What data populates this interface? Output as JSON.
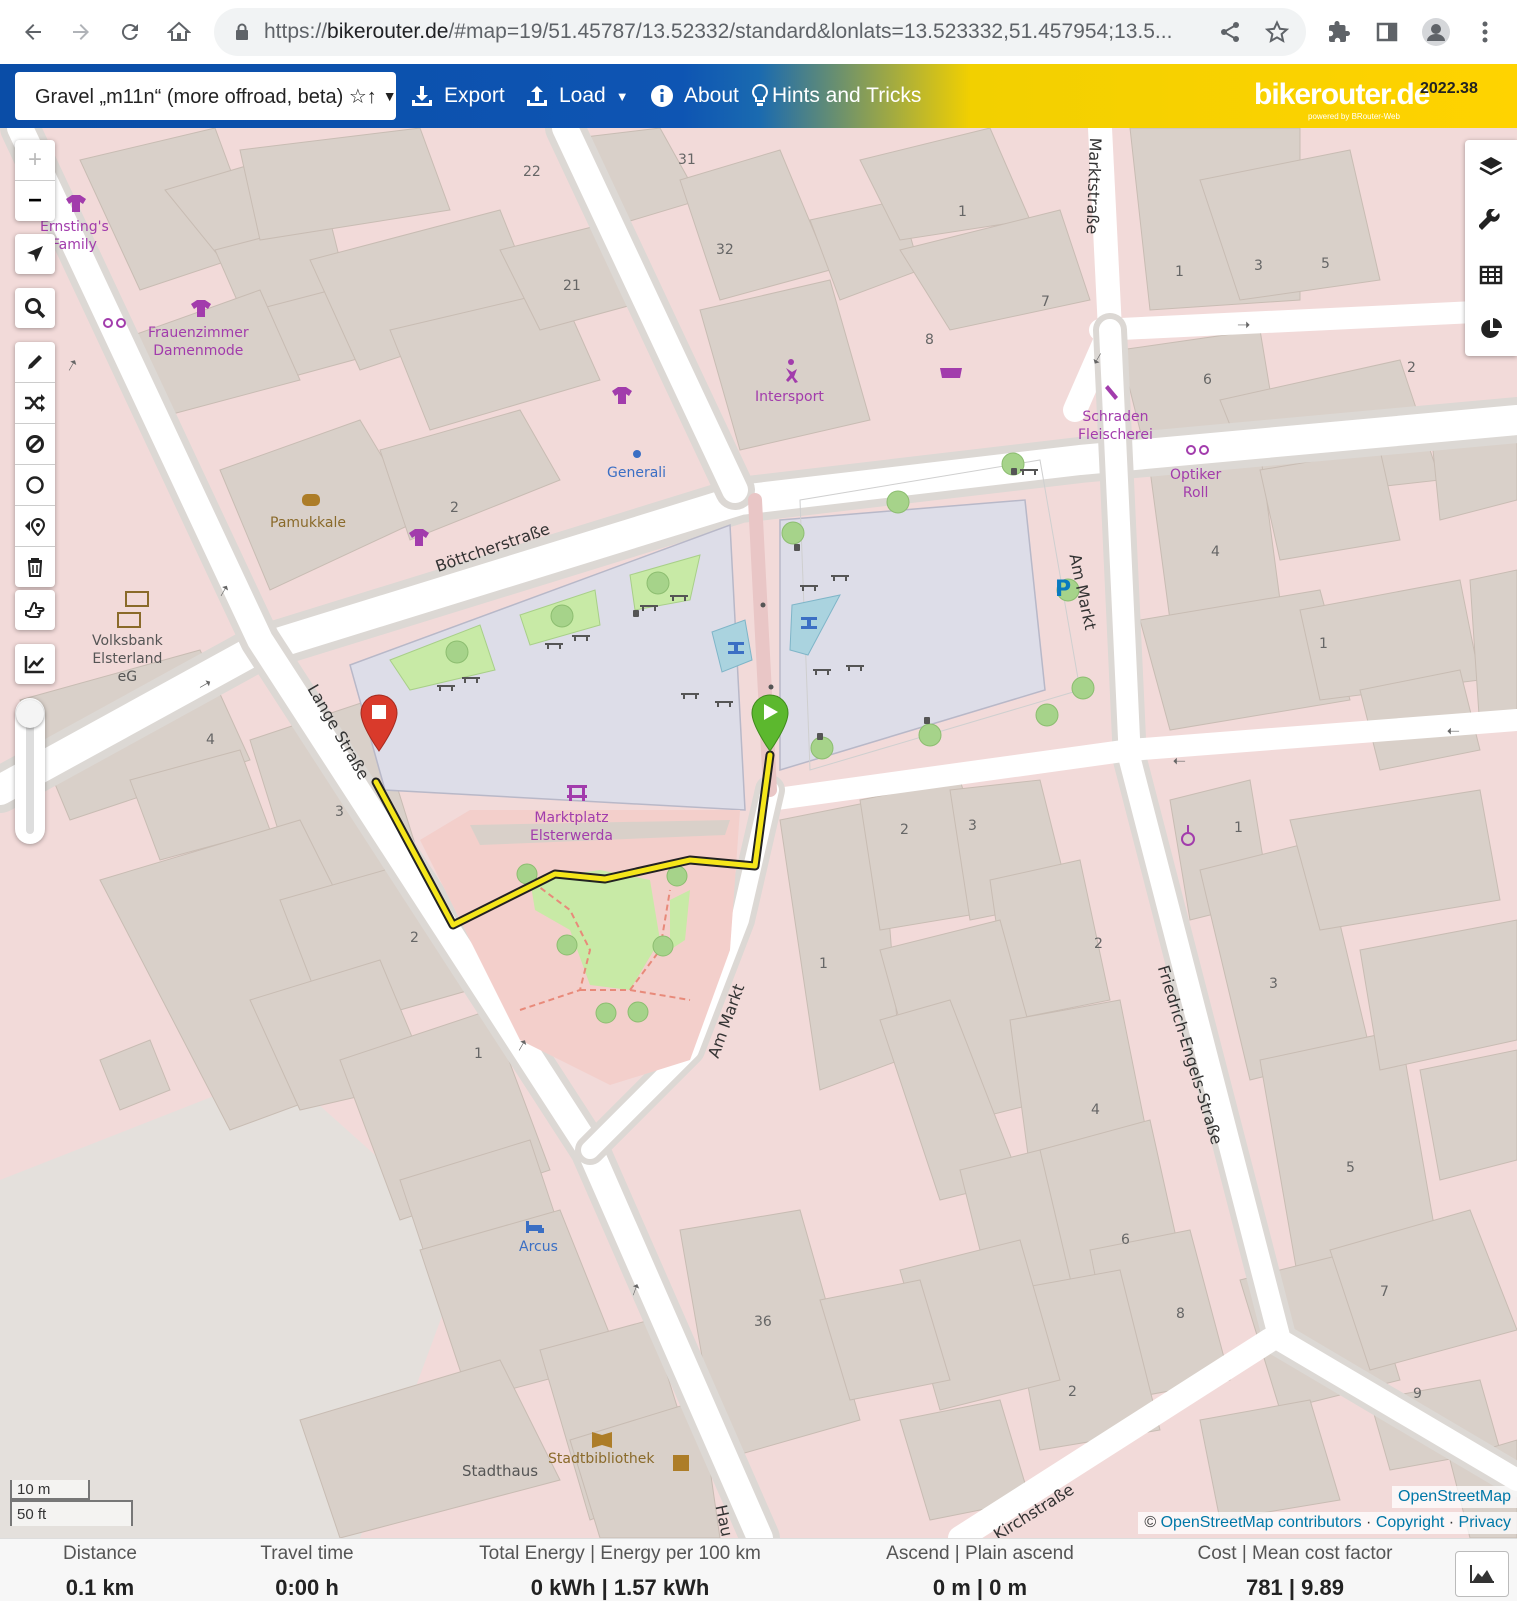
{
  "browser": {
    "url_prefix": "https://",
    "url_host": "bikerouter.de",
    "url_rest": "/#map=19/51.45787/13.52332/standard&lonlats=13.523332,51.457954;13.5..."
  },
  "toolbar": {
    "profile": "Gravel „m11n“ (more offroad, beta) ☆↑",
    "export": "Export",
    "load": "Load",
    "about": "About",
    "hints": "Hints and Tricks",
    "brand": "bikerouter.de",
    "brand_sub": "powered by BRouter-Web",
    "version": "2022.38"
  },
  "map": {
    "streets": {
      "boettcher": "Böttcherstraße",
      "lange": "Lange Straße",
      "markt_v": "Am Markt",
      "markt_s": "Am Markt",
      "marktstr": "Marktstraße",
      "friedrich": "Friedrich-Engels-Straße",
      "kirch": "Kirchstraße",
      "haupt": "Hau"
    },
    "pois": {
      "ernsting": "Ernsting's\nFamily",
      "frauenzimmer": "Frauenzimmer\nDamenmode",
      "intersport": "Intersport",
      "generali": "Generali",
      "schraden": "Schraden\nFleischerei",
      "optiker": "Optiker\nRoll",
      "pamukkale": "Pamukkale",
      "volksbank": "Volksbank\nElsterland\neG",
      "marktplatz": "Marktplatz\nElsterwerda",
      "arcus": "Arcus",
      "stadthaus": "Stadthaus",
      "stadtbibliothek": "Stadtbibliothek"
    },
    "housenumbers": {
      "n22": "22",
      "n21": "21",
      "n31": "31",
      "n32": "32",
      "n8": "8",
      "n7": "7",
      "n1a": "1",
      "n1b": "1",
      "n3a": "3",
      "n5a": "5",
      "n6": "6",
      "n2a": "2",
      "n4a": "4",
      "n1c": "1",
      "n2b": "2",
      "n4b": "4",
      "n3b": "3",
      "n2c": "2",
      "n1d": "1",
      "n2d": "2",
      "n3c": "3",
      "n1e": "1",
      "n2e": "2",
      "n3d": "3",
      "n1f": "1",
      "n4c": "4",
      "n5b": "5",
      "n6b": "6",
      "n8b": "8",
      "n36": "36",
      "n2f": "2",
      "n7b": "7",
      "n9": "9"
    },
    "scale": {
      "metric": "10 m",
      "imperial": "50 ft"
    },
    "attribution": {
      "osm": "OpenStreetMap",
      "copy": "©",
      "contributors": "OpenStreetMap contributors",
      "sep1": "·",
      "copyright": "Copyright",
      "sep2": "·",
      "privacy": "Privacy"
    }
  },
  "stats": {
    "distance": {
      "label": "Distance",
      "value": "0.1 km"
    },
    "travel": {
      "label": "Travel time",
      "value": "0:00 h"
    },
    "energy": {
      "label": "Total Energy | Energy per 100 km",
      "value": "0 kWh | 1.57 kWh"
    },
    "ascend": {
      "label": "Ascend | Plain ascend",
      "value": "0 m | 0 m"
    },
    "cost": {
      "label": "Cost | Mean cost factor",
      "value": "781 | 9.89"
    }
  },
  "colors": {
    "route": "#f5e61a",
    "start_marker": "#5cb82e",
    "end_marker": "#d93a2b",
    "building": "#d9d0c9",
    "residential": "#f2dad9",
    "plaza": "#dddde8",
    "grass": "#c8eaa6"
  },
  "icons": {
    "back": "arrow-left-icon",
    "forward": "arrow-right-icon",
    "reload": "reload-icon",
    "home": "home-icon",
    "lock": "lock-icon",
    "share": "share-icon",
    "star": "star-icon",
    "extensions": "puzzle-icon",
    "sidepanel": "sidepanel-icon",
    "profile": "profile-icon",
    "menu": "kebab-menu-icon"
  }
}
